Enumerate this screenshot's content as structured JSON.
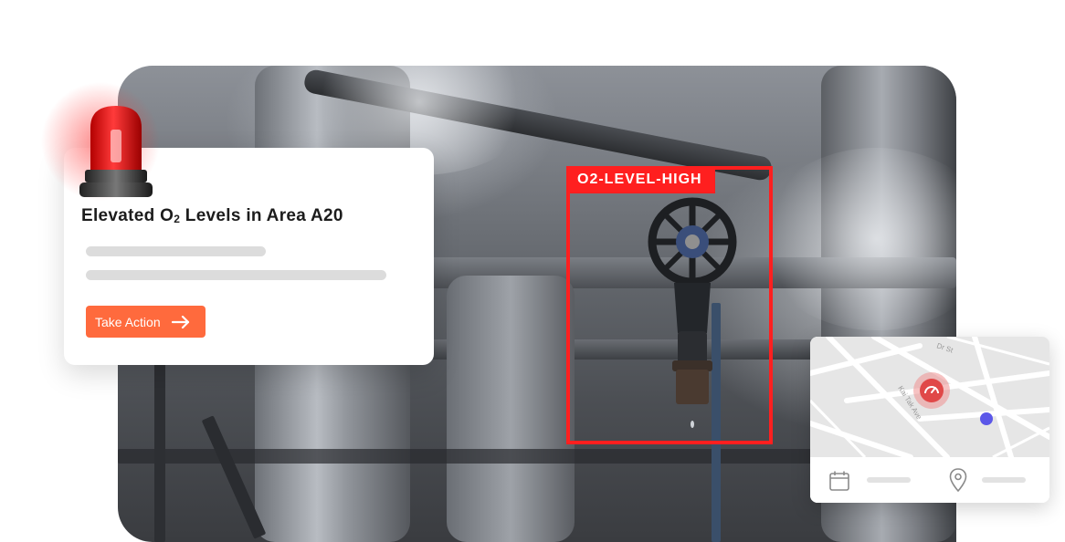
{
  "detection": {
    "label": "O2-LEVEL-HIGH"
  },
  "alert": {
    "title_prefix": "Elevated O",
    "title_subscript": "2",
    "title_suffix": " Levels in Area A20",
    "action_label": "Take Action"
  },
  "map": {
    "streets": [
      "Dr St",
      "Kai Tak Ave"
    ]
  },
  "colors": {
    "detection_red": "#ff1f1f",
    "action_orange": "#ff6a3d",
    "siren_red": "#e01010",
    "location_dot": "#5b57e8"
  },
  "icons": {
    "siren": "siren-icon",
    "arrow": "arrow-right-icon",
    "calendar": "calendar-icon",
    "pin": "map-pin-icon",
    "marker": "gauge-marker-icon"
  }
}
